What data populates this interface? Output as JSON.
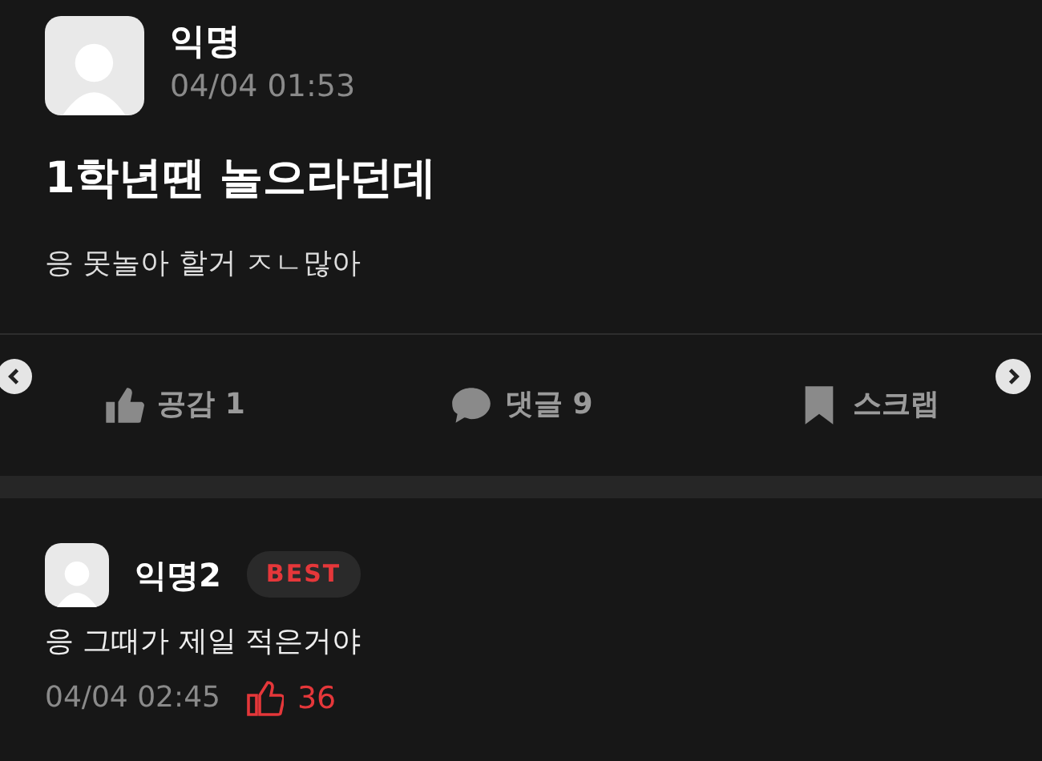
{
  "post": {
    "author": "익명",
    "time": "04/04 01:53",
    "title": "1학년땐 놀으라던데",
    "body": "응 못놀아 할거 ㅈㄴ많아"
  },
  "actions": [
    {
      "kind": "like",
      "label": "공감 1"
    },
    {
      "kind": "comment",
      "label": "댓글 9"
    },
    {
      "kind": "scrap",
      "label": "스크랩"
    }
  ],
  "comments": [
    {
      "author": "익명2",
      "badge": "BEST",
      "text": "응 그때가 제일 적은거야",
      "time": "04/04 02:45",
      "likes": "36"
    }
  ]
}
